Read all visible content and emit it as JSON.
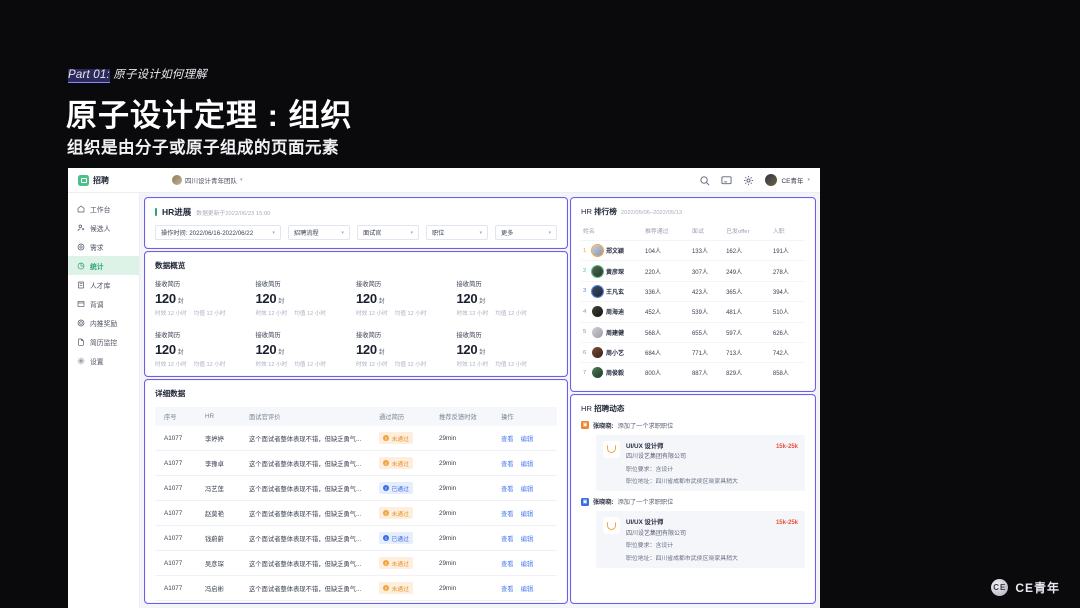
{
  "slide": {
    "eyebrow_part": "Part 01:",
    "eyebrow_rest": " 原子设计如何理解",
    "title": "原子设计定理 : 组织",
    "subtitle": "组织是由分子或原子组成的页面元素",
    "watermark": "CE青年",
    "watermark_mark": "CE"
  },
  "app": {
    "header": {
      "brand": "招聘",
      "team": "四川设计青年团队",
      "user": "CE青年",
      "icons": [
        "search-icon",
        "message-icon",
        "settings-icon"
      ]
    },
    "sidebar": [
      {
        "label": "工作台",
        "icon": "home-icon",
        "active": false
      },
      {
        "label": "候选人",
        "icon": "user-icon",
        "active": false
      },
      {
        "label": "需求",
        "icon": "target-icon",
        "active": false
      },
      {
        "label": "统计",
        "icon": "pie-chart-icon",
        "active": true
      },
      {
        "label": "人才库",
        "icon": "database-icon",
        "active": false
      },
      {
        "label": "背调",
        "icon": "archive-icon",
        "active": false
      },
      {
        "label": "内推奖励",
        "icon": "award-icon",
        "active": false
      },
      {
        "label": "简历监控",
        "icon": "file-icon",
        "active": false
      },
      {
        "label": "设置",
        "icon": "gear-icon",
        "active": false
      }
    ],
    "filter_panel": {
      "title": "HR进展",
      "meta": "数据更新于2022/06/23 15:00",
      "selects": [
        {
          "value": "操作时间: 2022/06/16-2022/06/22"
        },
        {
          "value": "招聘流程"
        },
        {
          "value": "面试官"
        },
        {
          "value": "职位"
        },
        {
          "value": "更多"
        }
      ]
    },
    "overview": {
      "title": "数据概览",
      "cards": [
        {
          "label": "接收简历",
          "value": "120",
          "unit": "封",
          "sub1": "时效 12 小时",
          "sub2": "均值 12 小时"
        },
        {
          "label": "接收简历",
          "value": "120",
          "unit": "封",
          "sub1": "时效 12 小时",
          "sub2": "均值 12 小时"
        },
        {
          "label": "接收简历",
          "value": "120",
          "unit": "封",
          "sub1": "时效 12 小时",
          "sub2": "均值 12 小时"
        },
        {
          "label": "接收简历",
          "value": "120",
          "unit": "封",
          "sub1": "时效 12 小时",
          "sub2": "均值 12 小时"
        },
        {
          "label": "接收简历",
          "value": "120",
          "unit": "封",
          "sub1": "时效 12 小时",
          "sub2": "均值 12 小时"
        },
        {
          "label": "接收简历",
          "value": "120",
          "unit": "封",
          "sub1": "时效 12 小时",
          "sub2": "均值 12 小时"
        },
        {
          "label": "接收简历",
          "value": "120",
          "unit": "封",
          "sub1": "时效 12 小时",
          "sub2": "均值 12 小时"
        },
        {
          "label": "接收简历",
          "value": "120",
          "unit": "封",
          "sub1": "时效 12 小时",
          "sub2": "均值 12 小时"
        }
      ]
    },
    "detail": {
      "title": "详细数据",
      "columns": [
        "序号",
        "HR",
        "面试官评价",
        "通过简历",
        "推荐反馈时效",
        "操作"
      ],
      "actions": {
        "view": "查看",
        "edit": "编辑"
      },
      "rows": [
        {
          "no": "A1077",
          "hr": "李婷婷",
          "comment": "这个面试者整体表现不错，但缺乏勇气...",
          "status": "未通过",
          "state": "fail",
          "time": "29min"
        },
        {
          "no": "A1077",
          "hr": "李豫卓",
          "comment": "这个面试者整体表现不错，但缺乏勇气...",
          "status": "未通过",
          "state": "fail",
          "time": "29min"
        },
        {
          "no": "A1077",
          "hr": "冯艺莲",
          "comment": "这个面试者整体表现不错，但缺乏勇气...",
          "status": "已通过",
          "state": "pass",
          "time": "29min"
        },
        {
          "no": "A1077",
          "hr": "赵莫艳",
          "comment": "这个面试者整体表现不错，但缺乏勇气...",
          "status": "未通过",
          "state": "fail",
          "time": "29min"
        },
        {
          "no": "A1077",
          "hr": "钱蔚蔚",
          "comment": "这个面试者整体表现不错，但缺乏勇气...",
          "status": "已通过",
          "state": "pass",
          "time": "29min"
        },
        {
          "no": "A1077",
          "hr": "吴彦琛",
          "comment": "这个面试者整体表现不错，但缺乏勇气...",
          "status": "未通过",
          "state": "fail",
          "time": "29min"
        },
        {
          "no": "A1077",
          "hr": "冯启彬",
          "comment": "这个面试者整体表现不错，但缺乏勇气...",
          "status": "未通过",
          "state": "fail",
          "time": "29min"
        }
      ]
    },
    "ranking": {
      "prefix": "HR",
      "title": "排行榜",
      "range": "2022/05/06–2022/05/13",
      "columns": [
        "姓名",
        "推荐通过",
        "面试",
        "已发offer",
        "入职"
      ],
      "rows": [
        {
          "rank": "1",
          "name": "郑文颖",
          "pass": "104人",
          "interview": "133人",
          "offer": "162人",
          "onboard": "191人"
        },
        {
          "rank": "2",
          "name": "黄彦琛",
          "pass": "220人",
          "interview": "307人",
          "offer": "249人",
          "onboard": "278人"
        },
        {
          "rank": "3",
          "name": "王凡玄",
          "pass": "336人",
          "interview": "423人",
          "offer": "365人",
          "onboard": "394人"
        },
        {
          "rank": "4",
          "name": "周海迪",
          "pass": "452人",
          "interview": "539人",
          "offer": "481人",
          "onboard": "510人"
        },
        {
          "rank": "5",
          "name": "周建健",
          "pass": "568人",
          "interview": "655人",
          "offer": "597人",
          "onboard": "626人"
        },
        {
          "rank": "6",
          "name": "周小艺",
          "pass": "684人",
          "interview": "771人",
          "offer": "713人",
          "onboard": "742人"
        },
        {
          "rank": "7",
          "name": "周俊毅",
          "pass": "800人",
          "interview": "887人",
          "offer": "829人",
          "onboard": "858人"
        }
      ]
    },
    "dynamics": {
      "prefix": "HR",
      "title": "招聘动态",
      "items": [
        {
          "who": "张晓晓:",
          "action": "添加了一个求职职位",
          "icon_color": "orange",
          "job": {
            "name": "UI/UX 设计师",
            "pay": "15k-25k",
            "company": "四川设艺集团有限公司",
            "req_label": "职位要求：",
            "req_value": "含设计",
            "addr_label": "职位地址：",
            "addr_value": "四川省成都市武侯区晓家具稍大"
          }
        },
        {
          "who": "张晓晓:",
          "action": "添加了一个求职职位",
          "icon_color": "blue",
          "job": {
            "name": "UI/UX 设计师",
            "pay": "15k-25k",
            "company": "四川设艺集团有限公司",
            "req_label": "职位要求：",
            "req_value": "含设计",
            "addr_label": "职位地址：",
            "addr_value": "四川省成都市武侯区晓家具稍大"
          }
        }
      ]
    }
  },
  "colors": {
    "organism_outline": "#6a5df0",
    "accent_green": "#2fa277",
    "accent_blue": "#4f7ff0",
    "accent_orange": "#f0a43c",
    "pay_red": "#e8503a",
    "slide_bg": "#0a0a0d"
  }
}
